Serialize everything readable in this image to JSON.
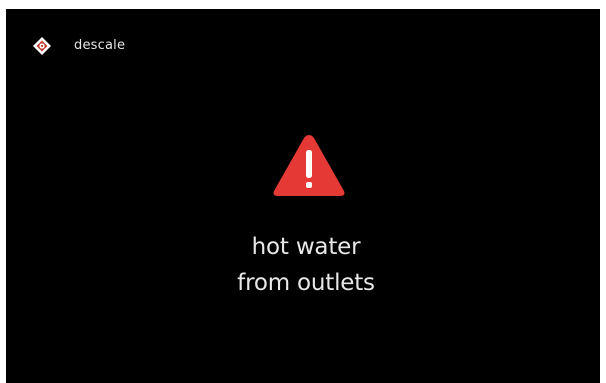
{
  "header": {
    "icon": "descale-diamond-icon",
    "label": "descale"
  },
  "warning": {
    "icon": "warning-triangle-icon",
    "color": "#e53935"
  },
  "message": {
    "line1": "hot water",
    "line2": "from outlets"
  }
}
